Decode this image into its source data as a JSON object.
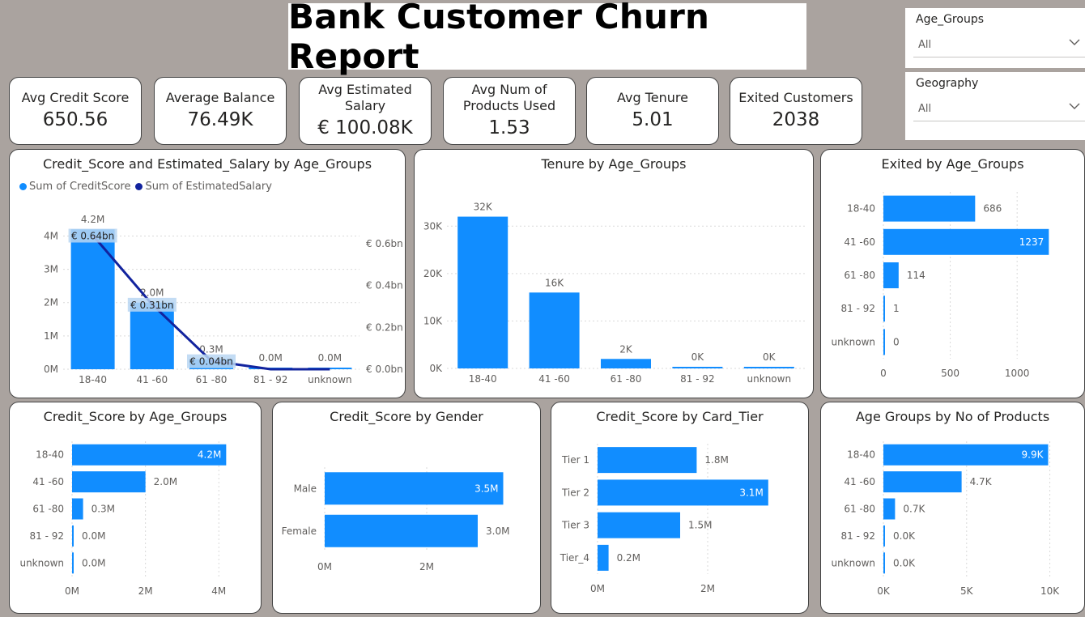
{
  "title": "Bank Customer Churn Report",
  "kpis": [
    {
      "label": "Avg Credit Score",
      "value": "650.56"
    },
    {
      "label": "Average Balance",
      "value": "76.49K"
    },
    {
      "label": "Avg Estimated Salary",
      "value": "€ 100.08K"
    },
    {
      "label": "Avg Num of Products Used",
      "value": "1.53"
    },
    {
      "label": "Avg Tenure",
      "value": "5.01"
    },
    {
      "label": "Exited Customers",
      "value": "2038"
    }
  ],
  "slicers": [
    {
      "title": "Age_Groups",
      "value": "All"
    },
    {
      "title": "Geography",
      "value": "All"
    }
  ],
  "colors": {
    "bar": "#118dff",
    "line": "#12239e",
    "label_bg": "#b9d6f2"
  },
  "chart_data": [
    {
      "type": "bar",
      "title": "Credit_Score and Estimated_Salary by Age_Groups",
      "categories": [
        "18-40",
        "41 -60",
        "61 -80",
        "81 - 92",
        "unknown"
      ],
      "series": [
        {
          "name": "Sum of CreditScore",
          "values": [
            4200000,
            2000000,
            300000,
            0,
            0
          ],
          "labels": [
            "4.2M",
            "2.0M",
            "0.3M",
            "0.0M",
            "0.0M"
          ],
          "axis": "left"
        },
        {
          "name": "Sum of EstimatedSalary",
          "type": "line",
          "values": [
            640000000,
            310000000,
            40000000,
            0,
            0
          ],
          "labels": [
            "€ 0.64bn",
            "€ 0.31bn",
            "€ 0.04bn"
          ],
          "axis": "right"
        }
      ],
      "y_ticks": [
        "0M",
        "1M",
        "2M",
        "3M",
        "4M"
      ],
      "y2_ticks": [
        "€ 0.0bn",
        "€ 0.2bn",
        "€ 0.4bn",
        "€ 0.6bn"
      ],
      "ylim": [
        0,
        4400000
      ],
      "y2lim": [
        0,
        700000000
      ]
    },
    {
      "type": "bar",
      "title": "Tenure by Age_Groups",
      "categories": [
        "18-40",
        "41 -60",
        "61 -80",
        "81 - 92",
        "unknown"
      ],
      "values": [
        32000,
        16000,
        2000,
        0,
        0
      ],
      "labels": [
        "32K",
        "16K",
        "2K",
        "0K",
        "0K"
      ],
      "y_ticks": [
        "0K",
        "10K",
        "20K",
        "30K"
      ],
      "ylim": [
        0,
        35000
      ]
    },
    {
      "type": "bar",
      "orientation": "horizontal",
      "title": "Exited by Age_Groups",
      "categories": [
        "18-40",
        "41 -60",
        "61 -80",
        "81 - 92",
        "unknown"
      ],
      "values": [
        686,
        1237,
        114,
        1,
        0
      ],
      "labels": [
        "686",
        "1237",
        "114",
        "1",
        "0"
      ],
      "x_ticks": [
        "0",
        "500",
        "1000"
      ],
      "xlim": [
        0,
        1350
      ]
    },
    {
      "type": "bar",
      "orientation": "horizontal",
      "title": "Credit_Score by Age_Groups",
      "categories": [
        "18-40",
        "41 -60",
        "61 -80",
        "81 - 92",
        "unknown"
      ],
      "values": [
        4200000,
        2000000,
        300000,
        0,
        0
      ],
      "labels": [
        "4.2M",
        "2.0M",
        "0.3M",
        "0.0M",
        "0.0M"
      ],
      "x_ticks": [
        "0M",
        "2M",
        "4M"
      ],
      "xlim": [
        0,
        4700000
      ]
    },
    {
      "type": "bar",
      "orientation": "horizontal",
      "title": "Credit_Score by Gender",
      "categories": [
        "Male",
        "Female"
      ],
      "values": [
        3500000,
        3000000
      ],
      "labels": [
        "3.5M",
        "3.0M"
      ],
      "x_ticks": [
        "0M",
        "2M"
      ],
      "xlim": [
        0,
        4000000
      ]
    },
    {
      "type": "bar",
      "orientation": "horizontal",
      "title": "Credit_Score by Card_Tier",
      "categories": [
        "Tier 1",
        "Tier 2",
        "Tier 3",
        "Tier_4"
      ],
      "values": [
        1800000,
        3100000,
        1500000,
        200000
      ],
      "labels": [
        "1.8M",
        "3.1M",
        "1.5M",
        "0.2M"
      ],
      "x_ticks": [
        "0M",
        "2M"
      ],
      "xlim": [
        0,
        3500000
      ]
    },
    {
      "type": "bar",
      "orientation": "horizontal",
      "title": "Age Groups by No of Products",
      "categories": [
        "18-40",
        "41 -60",
        "61 -80",
        "81 - 92",
        "unknown"
      ],
      "values": [
        9900,
        4700,
        700,
        0,
        0
      ],
      "labels": [
        "9.9K",
        "4.7K",
        "0.7K",
        "0.0K",
        "0.0K"
      ],
      "x_ticks": [
        "0K",
        "5K",
        "10K"
      ],
      "xlim": [
        0,
        10800
      ]
    }
  ]
}
